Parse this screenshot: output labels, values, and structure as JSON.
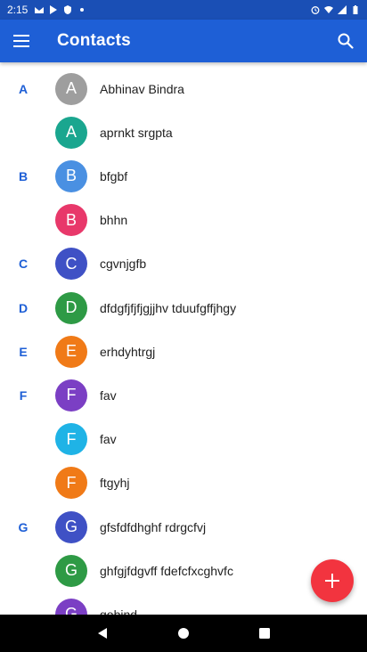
{
  "status_bar": {
    "time": "2:15"
  },
  "app_bar": {
    "title": "Contacts",
    "menu_icon": "hamburger-menu-icon",
    "search_icon": "search-icon"
  },
  "contacts": [
    {
      "section": "A",
      "initial": "A",
      "name": "Abhinav Bindra",
      "color": "#9e9e9e"
    },
    {
      "section": "",
      "initial": "A",
      "name": "aprnkt srgpta",
      "color": "#1aa68f"
    },
    {
      "section": "B",
      "initial": "B",
      "name": "bfgbf",
      "color": "#4a90e2"
    },
    {
      "section": "",
      "initial": "B",
      "name": "bhhn",
      "color": "#e8386a"
    },
    {
      "section": "C",
      "initial": "C",
      "name": "cgvnjgfb",
      "color": "#3f51c5"
    },
    {
      "section": "D",
      "initial": "D",
      "name": "dfdgfjfjfjgjjhv tduufgffjhgy",
      "color": "#2e9a45"
    },
    {
      "section": "E",
      "initial": "E",
      "name": "erhdyhtrgj",
      "color": "#f07a17"
    },
    {
      "section": "F",
      "initial": "F",
      "name": "fav",
      "color": "#7b3fc4"
    },
    {
      "section": "",
      "initial": "F",
      "name": "fav",
      "color": "#1fb3e6"
    },
    {
      "section": "",
      "initial": "F",
      "name": "ftgyhj",
      "color": "#f07a17"
    },
    {
      "section": "G",
      "initial": "G",
      "name": "gfsfdfdhghf rdrgcfvj",
      "color": "#3f51c5"
    },
    {
      "section": "",
      "initial": "G",
      "name": "ghfgjfdgvff fdefcfxcghvfc",
      "color": "#2e9a45"
    },
    {
      "section": "",
      "initial": "G",
      "name": "gobind",
      "color": "#7b3fc4"
    }
  ],
  "fab": {
    "icon": "plus-icon",
    "color": "#f2343f"
  },
  "colors": {
    "primary": "#1e5fd6",
    "status_bar": "#1a4fb5",
    "section_letter": "#1e5fd6"
  }
}
